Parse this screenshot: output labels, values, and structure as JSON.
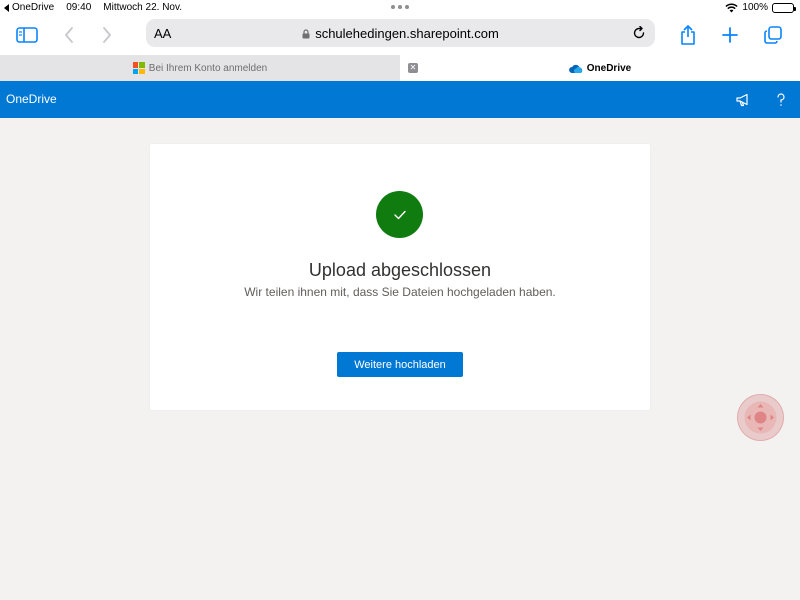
{
  "status_bar": {
    "back_app": "OneDrive",
    "time": "09:40",
    "date": "Mittwoch 22. Nov.",
    "battery": "100%"
  },
  "browser": {
    "aa_label": "AA",
    "url": "schulehedingen.sharepoint.com",
    "tabs": [
      {
        "label": "Bei Ihrem Konto anmelden",
        "active": false
      },
      {
        "label": "OneDrive",
        "active": true
      }
    ]
  },
  "header": {
    "brand": "OneDrive"
  },
  "card": {
    "title": "Upload abgeschlossen",
    "subtitle": "Wir teilen ihnen mit, dass Sie Dateien hochgeladen haben.",
    "button_label": "Weitere hochladen"
  },
  "colors": {
    "brand_blue": "#0078d4",
    "success_green": "#107c10",
    "safari_accent": "#0a84ff"
  }
}
